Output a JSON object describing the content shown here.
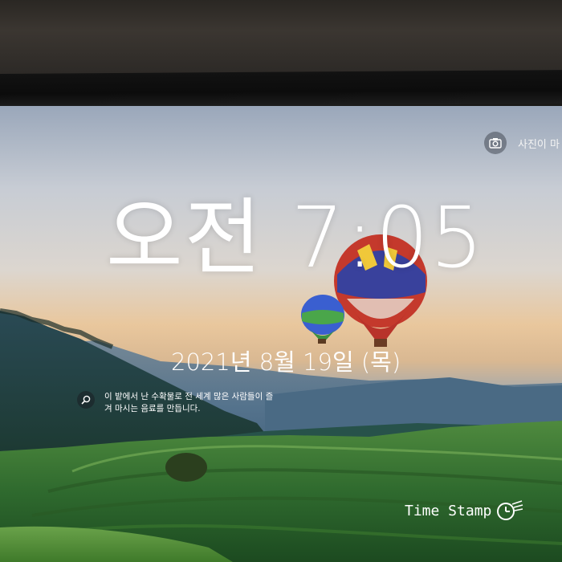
{
  "lockscreen": {
    "photo_link_label": "사진이 마",
    "time": "오전 7:05",
    "date": "2021년 8월 19일 (목)",
    "spotlight_text": "이 밭에서 난 수확물로 전 세계 많은 사람들이 즐겨 마시는 음료를 만듭니다.",
    "icons": {
      "camera": "camera-icon",
      "search": "search-icon"
    }
  },
  "watermark": {
    "label": "Time Stamp",
    "icon": "clock-icon"
  },
  "colors": {
    "text": "#ffffff",
    "sky_top": "#9ca9bd",
    "horizon": "#e7c08f",
    "hills": "#2f6a3a"
  }
}
